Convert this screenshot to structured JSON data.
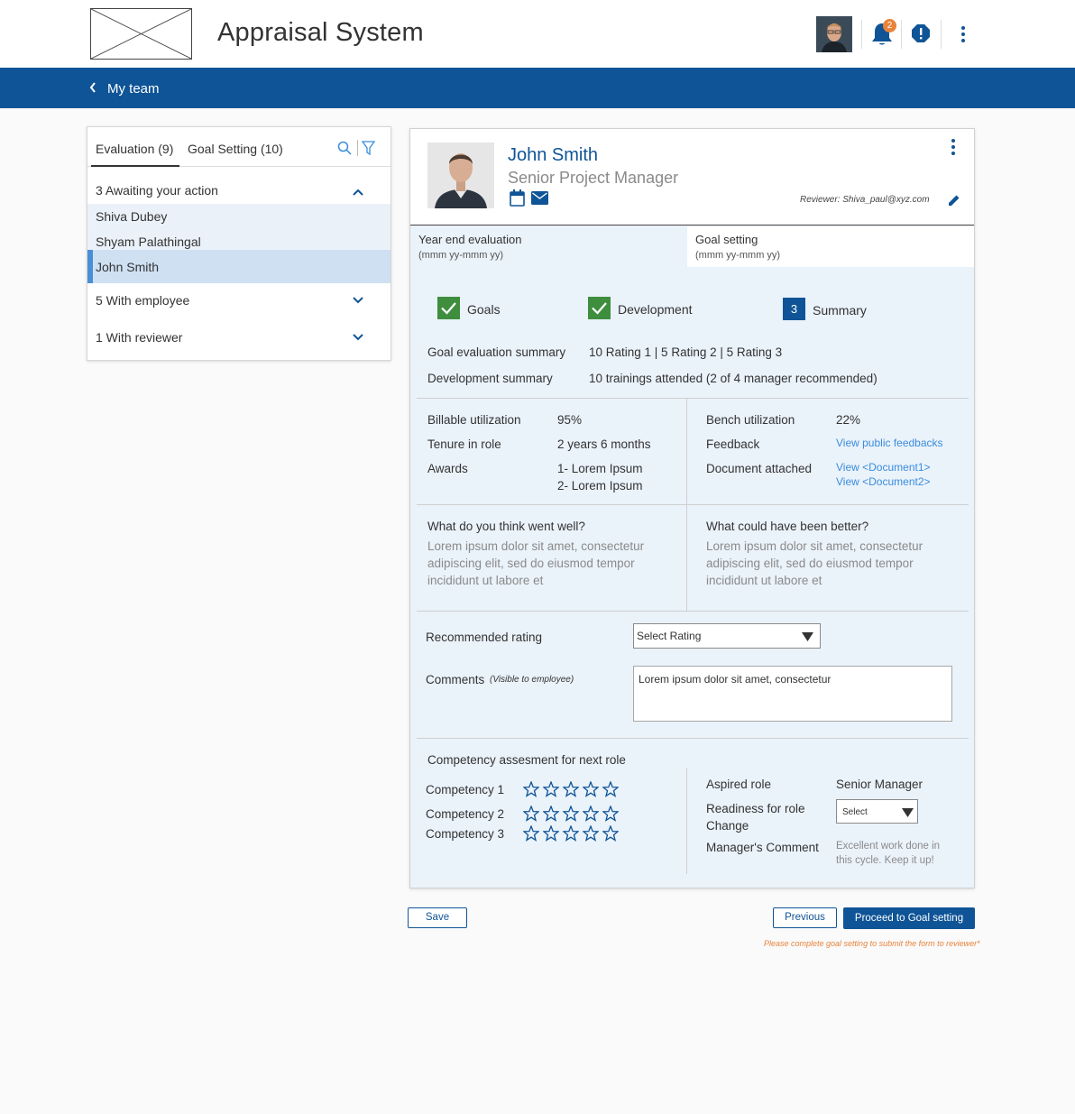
{
  "app": {
    "title": "Appraisal System",
    "notification_count": "2"
  },
  "nav": {
    "title": "My team"
  },
  "left_panel": {
    "tabs": [
      {
        "label": "Evaluation (9)"
      },
      {
        "label": "Goal Setting (10)"
      }
    ],
    "groups": [
      {
        "label": "3 Awaiting your action",
        "expanded": true,
        "members": [
          "Shiva Dubey",
          "Shyam Palathingal",
          "John Smith"
        ],
        "selected_member": "John Smith"
      },
      {
        "label": "5 With employee",
        "expanded": false
      },
      {
        "label": "1 With reviewer",
        "expanded": false
      }
    ]
  },
  "employee": {
    "name": "John Smith",
    "role": "Senior Project Manager",
    "reviewer": "Reviewer: Shiva_paul@xyz.com"
  },
  "phases": [
    {
      "title": "Year end evaluation",
      "period": "(mmm yy-mmm yy)"
    },
    {
      "title": "Goal setting",
      "period": "(mmm yy-mmm yy)"
    }
  ],
  "steps": [
    {
      "label": "Goals",
      "state": "done"
    },
    {
      "label": "Development",
      "state": "done"
    },
    {
      "label": "Summary",
      "state": "current",
      "number": "3"
    }
  ],
  "summary": {
    "goal_label": "Goal evaluation summary",
    "goal_value": "10 Rating 1 | 5 Rating 2 | 5 Rating 3",
    "dev_label": "Development summary",
    "dev_value": "10 trainings attended (2 of 4 manager recommended)"
  },
  "stats": {
    "billable_label": "Billable utilization",
    "billable_value": "95%",
    "tenure_label": "Tenure in role",
    "tenure_value": "2 years 6 months",
    "awards_label": "Awards",
    "award_1": "1- Lorem Ipsum",
    "award_2": "2- Lorem Ipsum",
    "bench_label": "Bench utilization",
    "bench_value": "22%",
    "feedback_label": "Feedback",
    "feedback_link": "View public feedbacks",
    "doc_label": "Document attached",
    "doc_1": "View <Document1>",
    "doc_2": "View <Document2>"
  },
  "reflection": {
    "well_q": "What do you think went well?",
    "well_a1": "Lorem ipsum dolor sit amet, consectetur",
    "well_a2": "adipiscing elit, sed do eiusmod tempor",
    "well_a3": "incididunt ut labore et",
    "better_q": "What could have been better?",
    "better_a1": "Lorem ipsum dolor sit amet, consectetur",
    "better_a2": "adipiscing elit, sed do eiusmod tempor",
    "better_a3": "incididunt ut labore et"
  },
  "rating": {
    "label": "Recommended rating",
    "select_value": "Select Rating",
    "comments_label": "Comments",
    "comments_hint": "(Visible to employee)",
    "comments_value": "Lorem ipsum dolor sit amet, consectetur"
  },
  "competency": {
    "heading": "Competency assesment for next role",
    "items": [
      {
        "label": "Competency 1",
        "stars": 0,
        "max_stars": 5
      },
      {
        "label": "Competency 2",
        "stars": 0,
        "max_stars": 5
      },
      {
        "label": "Competency 3",
        "stars": 0,
        "max_stars": 5
      }
    ],
    "aspired_label": "Aspired role",
    "aspired_value": "Senior Manager",
    "readiness_label_1": "Readiness for role",
    "readiness_label_2": "Change",
    "readiness_select": "Select",
    "mgr_comment_label": "Manager's Comment",
    "mgr_comment_1": "Excellent work done in",
    "mgr_comment_2": "this cycle. Keep it up!"
  },
  "actions": {
    "save": "Save",
    "previous": "Previous",
    "proceed": "Proceed to Goal setting",
    "footnote": "Please complete goal setting to submit the form to reviewer*"
  },
  "colors": {
    "primary": "#0f5496",
    "check_green": "#3e8e3e",
    "badge_orange": "#e8833a",
    "link_blue": "#3a8dde",
    "panel_bg": "#eaf2fa"
  },
  "icons": [
    "logo-placeholder",
    "avatar",
    "bell-icon",
    "alert-icon",
    "kebab-icon",
    "back-chevron-icon",
    "search-icon",
    "filter-icon",
    "chevron-up-icon",
    "chevron-down-icon",
    "calendar-icon",
    "mail-icon",
    "edit-icon",
    "check-icon",
    "star-outline-icon",
    "dropdown-arrow-icon"
  ]
}
